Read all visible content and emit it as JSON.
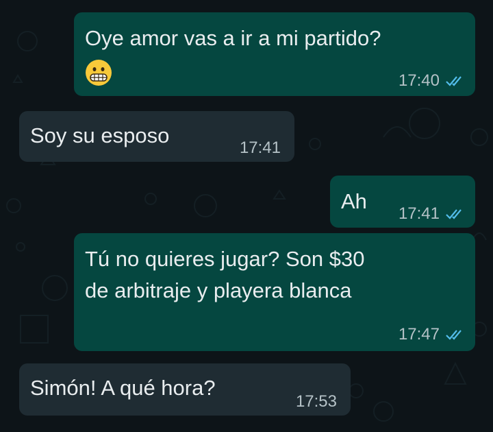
{
  "colors": {
    "background": "#0d1418",
    "outgoing_bubble": "#054740",
    "incoming_bubble": "#1f2c33",
    "text": "#e9edef",
    "timestamp": "#b5c2c7",
    "read_ticks": "#53bdeb"
  },
  "messages": [
    {
      "direction": "outgoing",
      "text": "Oye amor vas a ir a mi partido?",
      "emoji": "grimacing-face",
      "time": "17:40",
      "status": "read"
    },
    {
      "direction": "incoming",
      "text": "Soy su esposo",
      "time": "17:41"
    },
    {
      "direction": "outgoing",
      "text": "Ah",
      "time": "17:41",
      "status": "read"
    },
    {
      "direction": "outgoing",
      "text_lines": [
        "Tú no quieres jugar? Son $30",
        "de arbitraje y playera blanca"
      ],
      "time": "17:47",
      "status": "read"
    },
    {
      "direction": "incoming",
      "text": "Simón! A qué hora?",
      "time": "17:53"
    }
  ]
}
